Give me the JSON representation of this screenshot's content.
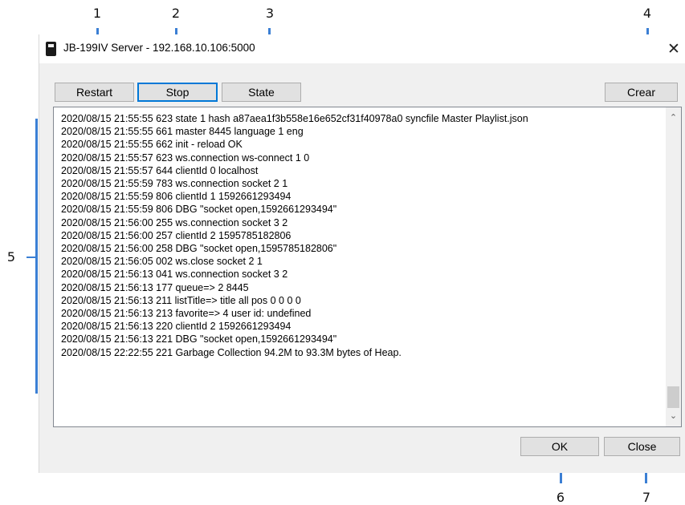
{
  "callouts": [
    "1",
    "2",
    "3",
    "4",
    "5",
    "6",
    "7"
  ],
  "window": {
    "title": "JB-199IV Server - 192.168.10.106:5000",
    "close_glyph": "✕"
  },
  "toolbar": {
    "restart_label": "Restart",
    "stop_label": "Stop",
    "state_label": "State",
    "clear_label": "Crear"
  },
  "log": {
    "lines": [
      "2020/08/15 21:55:55 623 state 1 hash a87aea1f3b558e16e652cf31f40978a0 syncfile Master Playlist.json",
      "2020/08/15 21:55:55 661 master 8445 language 1 eng",
      "2020/08/15 21:55:55 662 init - reload OK",
      "2020/08/15 21:55:57 623 ws.connection ws-connect 1 0",
      "2020/08/15 21:55:57 644 clientId 0 localhost",
      "2020/08/15 21:55:59 783 ws.connection socket 2 1",
      "2020/08/15 21:55:59 806 clientId 1 1592661293494",
      "2020/08/15 21:55:59 806 DBG \"socket open,1592661293494\"",
      "2020/08/15 21:56:00 255 ws.connection socket 3 2",
      "2020/08/15 21:56:00 257 clientId 2 1595785182806",
      "2020/08/15 21:56:00 258 DBG \"socket open,1595785182806\"",
      "2020/08/15 21:56:05 002 ws.close socket 2 1",
      "2020/08/15 21:56:13 041 ws.connection socket 3 2",
      "2020/08/15 21:56:13 177 queue=> 2 8445",
      "2020/08/15 21:56:13 211 listTitle=> title all   pos 0 0 0 0",
      "2020/08/15 21:56:13 213 favorite=> 4 user  id: undefined",
      "2020/08/15 21:56:13 220 clientId 2 1592661293494",
      "2020/08/15 21:56:13 221 DBG \"socket open,1592661293494\"",
      "2020/08/15 22:22:55 221 Garbage Collection 94.2M to 93.3M bytes of Heap."
    ]
  },
  "footer": {
    "ok_label": "OK",
    "close_label": "Close"
  },
  "icons": {
    "scroll_up": "⌃",
    "scroll_down": "⌄"
  },
  "colors": {
    "callout_line": "#3b7fd4",
    "focus_border": "#0078d7"
  }
}
